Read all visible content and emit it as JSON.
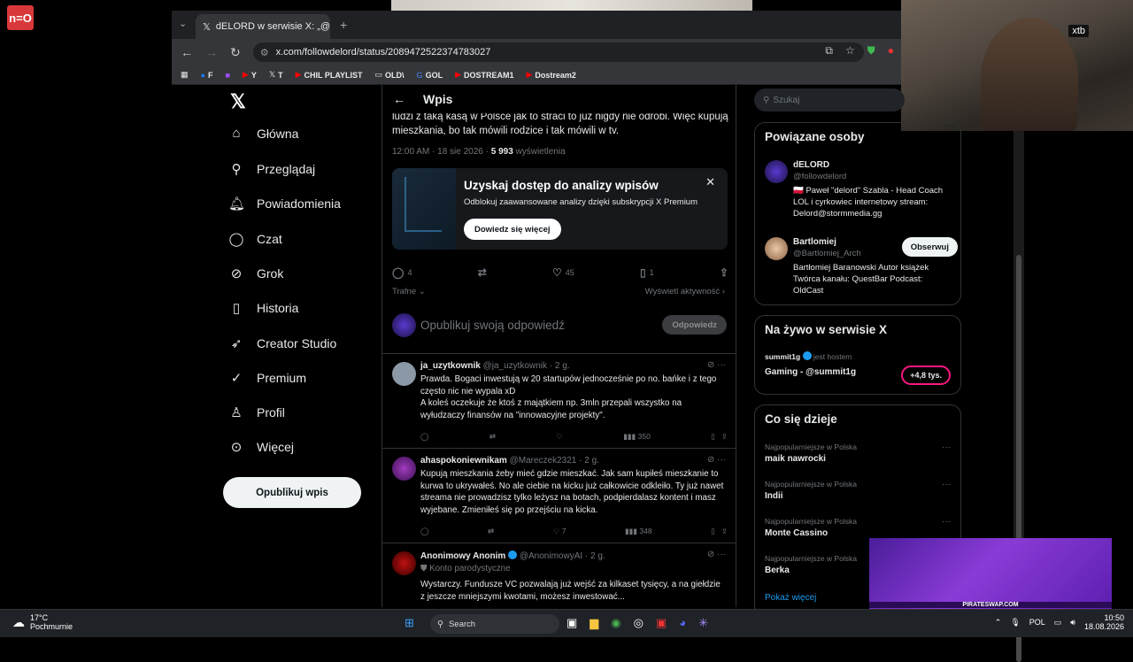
{
  "stream_logo": "n=O",
  "browser": {
    "tab_title": "dELORD w serwisie X: „@Bartlo…",
    "url": "x.com/followdelord/status/2089472522374783027",
    "bookmarks": [
      "F",
      "Y",
      "T",
      "CHIL PLAYLIST",
      "OLD\\",
      "GOL",
      "DOSTREAM1",
      "Dostream2"
    ]
  },
  "webcam": {
    "badge": "xtb"
  },
  "nav": {
    "items": [
      "Główna",
      "Przeglądaj",
      "Powiadomienia",
      "Czat",
      "Grok",
      "Historia",
      "Creator Studio",
      "Premium",
      "Profil",
      "Więcej"
    ],
    "post_button": "Opublikuj wpis"
  },
  "main": {
    "header_title": "Wpis",
    "post_text": "ludzi z taką kasą w Polsce jak to straci to już nigdy nie odrobi. Więc kupują mieszkania, bo tak mówili rodzice i tak mówili w tv.",
    "meta_time": "12:00 AM · 18 sie 2026 · ",
    "meta_views": "5 993",
    "meta_views_label": " wyświetlenia",
    "promo": {
      "title": "Uzyskaj dostęp do analizy wpisów",
      "subtitle": "Odblokuj zaawansowane analizy dzięki subskrypcji X Premium",
      "button": "Dowiedz się więcej"
    },
    "actions": {
      "replies": "4",
      "likes": "45",
      "bookmarks": "1"
    },
    "sort_label": "Trafne",
    "view_activity": "Wyświetl aktywność",
    "reply_placeholder": "Opublikuj swoją odpowiedź",
    "reply_button": "Odpowiedz",
    "replies": [
      {
        "name": "ja_uzytkownik",
        "handle": "@ja_uzytkownik · 2 g.",
        "text": "Prawda. Bogaci inwestują w 20 startupów jednocześnie po no. bańke i z tego często nic nie wypala xD\nA koleś oczekuje że ktoś z majątkiem np. 3mln przepali wszystko na wyłudzaczy finansów na \"innowacyjne projekty\".",
        "views": "350",
        "likes": ""
      },
      {
        "name": "ahaspokoniewnikam",
        "handle": "@Mareczek2321 · 2 g.",
        "text": "Kupują mieszkania  żeby mieć gdzie mieszkać. Jak sam kupiłeś mieszkanie to kurwa to ukrywałeś. No ale ciebie na kicku już całkowicie odkleiło. Ty już nawet streama nie prowadzisz tylko leżysz na botach, podpierdalasz kontent i masz wyjebane. Zmieniłeś się po przejściu na kicka.",
        "views": "348",
        "likes": "7"
      },
      {
        "name": "Anonimowy Anonim",
        "handle": "@AnonimowyAI · 2 g.",
        "label": "Konto parodystyczne",
        "text": "Wystarczy. Fundusze VC pozwalają już wejść za kilkaset tysięcy, a na giełdzie z jeszcze mniejszymi kwotami, możesz inwestować..."
      }
    ]
  },
  "right": {
    "search_placeholder": "Szukaj",
    "related_title": "Powiązane osoby",
    "people": [
      {
        "name": "dELORD",
        "handle": "@followdelord",
        "bio": "🇵🇱 Paweł \"delord\" Szabla - Head Coach LOL i cyrkowiec internetowy stream: Delord@stormmedia.gg"
      },
      {
        "name": "Bartlomiej",
        "handle": "@Bartlomiej_Arch",
        "bio": "Bartłomiej Baranowski Autor książek Twórca kanału: QuestBar Podcast: OldCast",
        "follow": "Obserwuj"
      }
    ],
    "live_title": "Na żywo w serwisie X",
    "live_host": "summit1g",
    "live_host_suffix": "jest hostem",
    "live_name": "Gaming - @summit1g",
    "live_count": "+4,8 tys.",
    "trends_title": "Co się dzieje",
    "trends": [
      {
        "cat": "Najpopularniejsze w Polska",
        "name": "maik nawrocki"
      },
      {
        "cat": "Najpopularniejsze w Polska",
        "name": "Indii"
      },
      {
        "cat": "Najpopularniejsze w Polska",
        "name": "Monte Cassino"
      },
      {
        "cat": "Najpopularniejsze w Polska",
        "name": "Berka"
      }
    ],
    "show_more": "Pokaż więcej"
  },
  "ad_text": "PIRATESWAP.COM",
  "taskbar": {
    "temp": "17°C",
    "weather": "Pochmurnie",
    "search": "Search",
    "lang": "POL",
    "time": "10:50",
    "date": "18.08.2026"
  }
}
